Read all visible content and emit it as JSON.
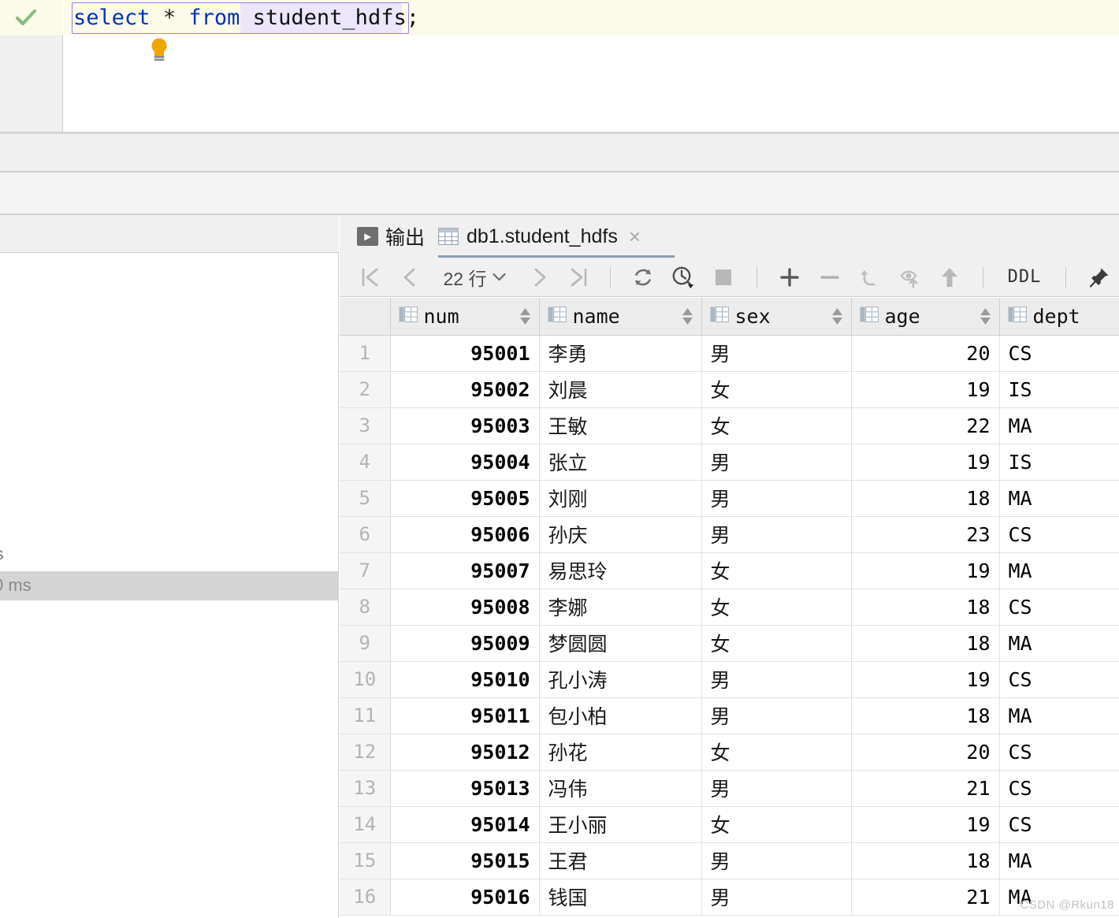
{
  "editor": {
    "status_icon": "check-icon",
    "hint_icon": "lightbulb-icon",
    "sql": {
      "kw_select": "select",
      "op_star": "*",
      "kw_from": "from",
      "table": "student_hdfs",
      "semicolon": ";",
      "full_text": "select * from student_hdfs;"
    }
  },
  "left_panel": {
    "clipped_text_top": "s",
    "clipped_text_selected": "0 ms"
  },
  "results": {
    "tabs": [
      {
        "label": "输出",
        "icon": "console-output-icon",
        "active": false,
        "closable": false
      },
      {
        "label": "db1.student_hdfs",
        "icon": "table-grid-icon",
        "active": true,
        "closable": true
      }
    ],
    "close_glyph": "×",
    "toolbar": {
      "first_page_label": "|<",
      "prev_page_label": "<",
      "row_count": "22 行",
      "row_count_chevron": "⌄",
      "next_page_label": ">",
      "last_page_label": ">|",
      "refresh_icon": "refresh-icon",
      "history_icon": "transaction-history-icon",
      "stop_icon": "stop-icon",
      "add_row_label": "+",
      "delete_row_label": "−",
      "revert_icon": "revert-icon",
      "revert_selected_icon": "revert-selected-icon",
      "submit_icon": "submit-arrow-icon",
      "ddl_label": "DDL",
      "pin_icon": "pin-icon"
    },
    "columns": [
      {
        "key": "num",
        "label": "num",
        "icon": "column-icon",
        "sortable": true
      },
      {
        "key": "name",
        "label": "name",
        "icon": "column-icon",
        "sortable": true
      },
      {
        "key": "sex",
        "label": "sex",
        "icon": "column-icon",
        "sortable": true
      },
      {
        "key": "age",
        "label": "age",
        "icon": "column-icon",
        "sortable": true
      },
      {
        "key": "dept",
        "label": "dept",
        "icon": "column-icon",
        "sortable": false
      }
    ],
    "rows": [
      {
        "n": "1",
        "num": "95001",
        "name": "李勇",
        "sex": "男",
        "age": "20",
        "dept": "CS"
      },
      {
        "n": "2",
        "num": "95002",
        "name": "刘晨",
        "sex": "女",
        "age": "19",
        "dept": "IS"
      },
      {
        "n": "3",
        "num": "95003",
        "name": "王敏",
        "sex": "女",
        "age": "22",
        "dept": "MA"
      },
      {
        "n": "4",
        "num": "95004",
        "name": "张立",
        "sex": "男",
        "age": "19",
        "dept": "IS"
      },
      {
        "n": "5",
        "num": "95005",
        "name": "刘刚",
        "sex": "男",
        "age": "18",
        "dept": "MA"
      },
      {
        "n": "6",
        "num": "95006",
        "name": "孙庆",
        "sex": "男",
        "age": "23",
        "dept": "CS"
      },
      {
        "n": "7",
        "num": "95007",
        "name": "易思玲",
        "sex": "女",
        "age": "19",
        "dept": "MA"
      },
      {
        "n": "8",
        "num": "95008",
        "name": "李娜",
        "sex": "女",
        "age": "18",
        "dept": "CS"
      },
      {
        "n": "9",
        "num": "95009",
        "name": "梦圆圆",
        "sex": "女",
        "age": "18",
        "dept": "MA"
      },
      {
        "n": "10",
        "num": "95010",
        "name": "孔小涛",
        "sex": "男",
        "age": "19",
        "dept": "CS"
      },
      {
        "n": "11",
        "num": "95011",
        "name": "包小柏",
        "sex": "男",
        "age": "18",
        "dept": "MA"
      },
      {
        "n": "12",
        "num": "95012",
        "name": "孙花",
        "sex": "女",
        "age": "20",
        "dept": "CS"
      },
      {
        "n": "13",
        "num": "95013",
        "name": "冯伟",
        "sex": "男",
        "age": "21",
        "dept": "CS"
      },
      {
        "n": "14",
        "num": "95014",
        "name": "王小丽",
        "sex": "女",
        "age": "19",
        "dept": "CS"
      },
      {
        "n": "15",
        "num": "95015",
        "name": "王君",
        "sex": "男",
        "age": "18",
        "dept": "MA"
      },
      {
        "n": "16",
        "num": "95016",
        "name": "钱国",
        "sex": "男",
        "age": "21",
        "dept": "MA"
      }
    ]
  },
  "watermark": {
    "text": "CSDN @Rkun18"
  },
  "colors": {
    "keyword": "#0033b3",
    "selection_highlight": "#ece6fb",
    "current_line": "#fcfae9",
    "check_green": "#86bd7e",
    "bulb_orange": "#f0a500",
    "tab_underline": "#8c9cb3",
    "panel_bg": "#f0f0f0"
  }
}
